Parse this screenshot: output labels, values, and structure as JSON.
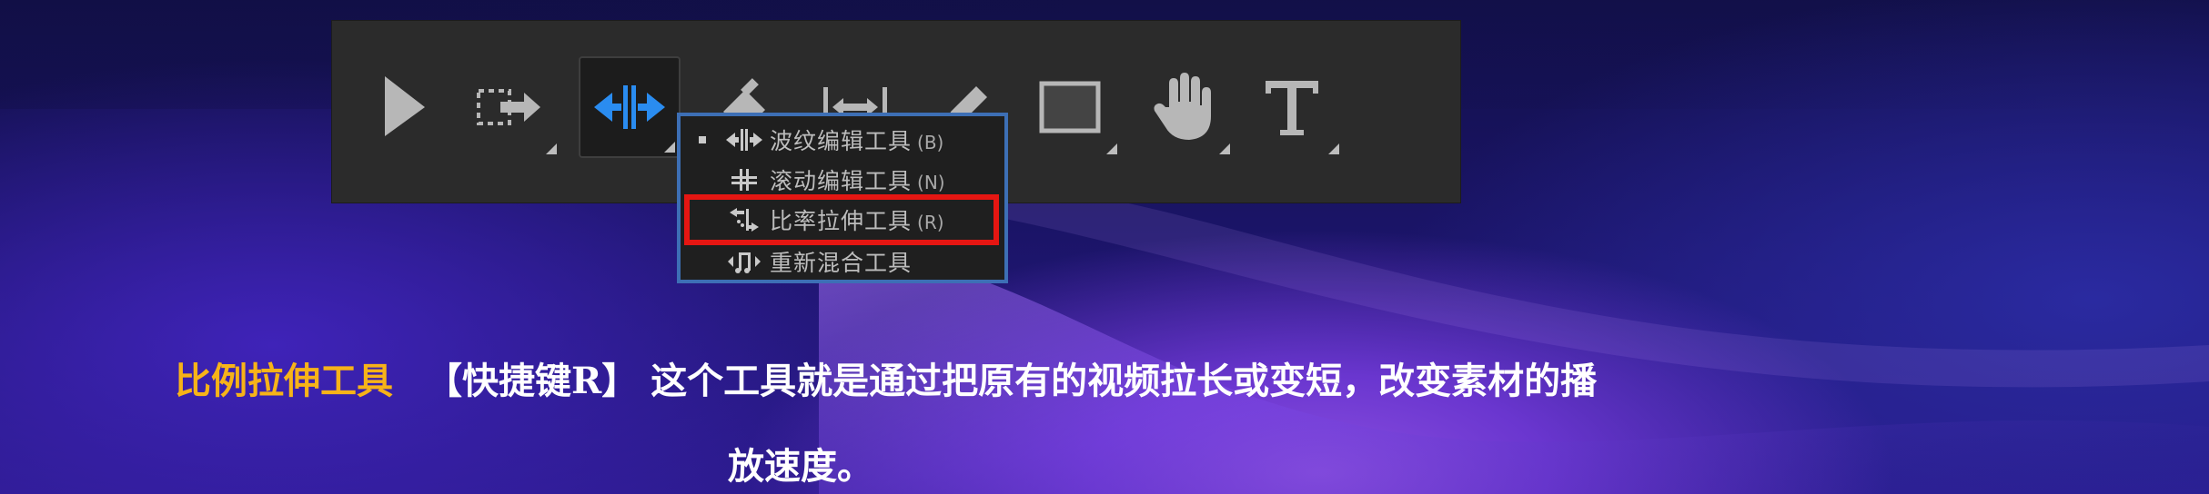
{
  "toolbar": {
    "tools": [
      {
        "name": "selection-tool",
        "icon": "arrow-cursor-icon"
      },
      {
        "name": "track-select-tool",
        "icon": "track-select-icon"
      },
      {
        "name": "ripple-edit-tool",
        "icon": "ripple-edit-icon",
        "active": true,
        "accent": "#2a8cf0"
      },
      {
        "name": "razor-tool",
        "icon": "razor-icon"
      },
      {
        "name": "slip-tool",
        "icon": "slip-icon"
      },
      {
        "name": "pen-tool",
        "icon": "pen-icon"
      },
      {
        "name": "rectangle-tool",
        "icon": "rectangle-icon"
      },
      {
        "name": "hand-tool",
        "icon": "hand-icon"
      },
      {
        "name": "type-tool",
        "icon": "type-icon"
      }
    ]
  },
  "menu": {
    "border_color": "#3d6fb5",
    "items": [
      {
        "label": "波纹编辑工具",
        "shortcut": "(B)",
        "icon": "ripple-edit-icon",
        "selected": true
      },
      {
        "label": "滚动编辑工具",
        "shortcut": "(N)",
        "icon": "rolling-edit-icon"
      },
      {
        "label": "比率拉伸工具",
        "shortcut": "(R)",
        "icon": "rate-stretch-icon",
        "highlighted": true
      },
      {
        "label": "重新混合工具",
        "shortcut": "",
        "icon": "remix-icon"
      }
    ],
    "highlight_color": "#e51612"
  },
  "caption": {
    "tool_name": "比例拉伸工具",
    "shortcut": "【快捷键R】",
    "line1": "这个工具就是通过把原有的视频拉长或变短，改变素材的播",
    "line2": "放速度。",
    "tool_name_color": "#f7b318"
  }
}
